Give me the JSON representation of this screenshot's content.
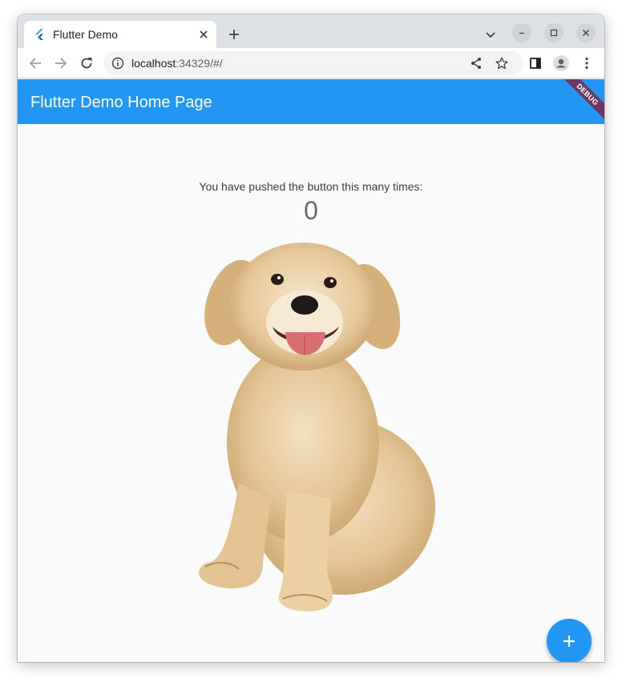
{
  "browser": {
    "tab": {
      "title": "Flutter Demo",
      "favicon": "flutter-logo-icon"
    },
    "url": {
      "host": "localhost",
      "rest": ":34329/#/"
    },
    "icons": [
      "back-icon",
      "forward-icon",
      "reload-icon",
      "site-info-icon",
      "share-icon",
      "bookmark-star-icon",
      "side-panel-icon",
      "profile-icon",
      "menu-icon"
    ]
  },
  "app": {
    "title": "Flutter Demo Home Page",
    "debug_banner": "DEBUG",
    "counter_label": "You have pushed the button this many times:",
    "counter_value": "0",
    "fab_icon": "plus-icon",
    "accent_color": "#2196f3",
    "image": "puppy-photo"
  }
}
